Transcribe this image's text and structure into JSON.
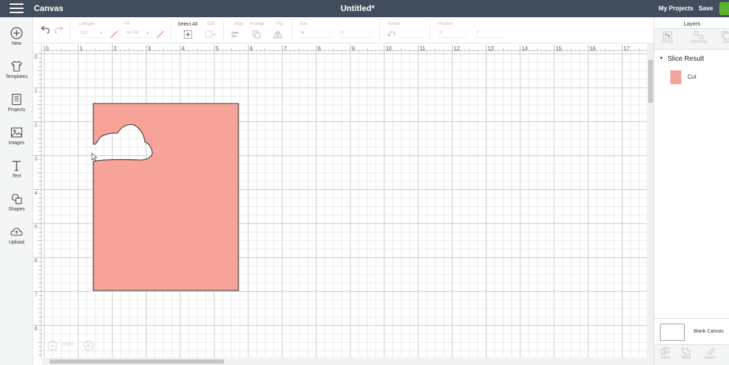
{
  "topbar": {
    "app_title": "Canvas",
    "doc_title": "Untitled*",
    "my_projects": "My Projects",
    "save": "Save",
    "make_color": "#5bb430"
  },
  "sidebar": {
    "items": [
      {
        "label": "New",
        "icon": "plus-circle-icon"
      },
      {
        "label": "Templates",
        "icon": "tshirt-icon"
      },
      {
        "label": "Projects",
        "icon": "projects-icon"
      },
      {
        "label": "Images",
        "icon": "image-icon"
      },
      {
        "label": "Text",
        "icon": "text-icon"
      },
      {
        "label": "Shapes",
        "icon": "shapes-icon"
      },
      {
        "label": "Upload",
        "icon": "upload-cloud-icon"
      }
    ]
  },
  "toolbar": {
    "linetype_label": "Linetype",
    "linetype_value": "Cut",
    "fill_label": "Fill",
    "fill_value": "No Fill",
    "select_all_label": "Select All",
    "edit_label": "Edit",
    "align_label": "Align",
    "arrange_label": "Arrange",
    "flip_label": "Flip",
    "size_label": "Size",
    "size_w": "W",
    "size_h": "H",
    "rotate_label": "Rotate",
    "position_label": "Position",
    "position_x": "X",
    "position_y": "Y"
  },
  "ruler": {
    "top": [
      "0",
      "1",
      "2",
      "3",
      "4",
      "5",
      "6",
      "7",
      "8",
      "9",
      "10",
      "11",
      "12",
      "13",
      "14",
      "15",
      "16",
      "17"
    ],
    "left": [
      "0",
      "1",
      "2",
      "3",
      "4",
      "5",
      "6",
      "7",
      "8"
    ]
  },
  "canvas": {
    "shape_fill": "#f7a398",
    "shape_stroke": "#333333",
    "zoom": "100%"
  },
  "layers_panel": {
    "tab": "Layers",
    "tools": [
      "Group",
      "UnGroup",
      "Du"
    ],
    "group_name": "Slice Result",
    "layer_name": "Cut",
    "layer_color": "#f4a398",
    "blank_canvas": "Blank Canvas",
    "bottom_tools": [
      "Slice",
      "Weld",
      "Attach"
    ]
  }
}
